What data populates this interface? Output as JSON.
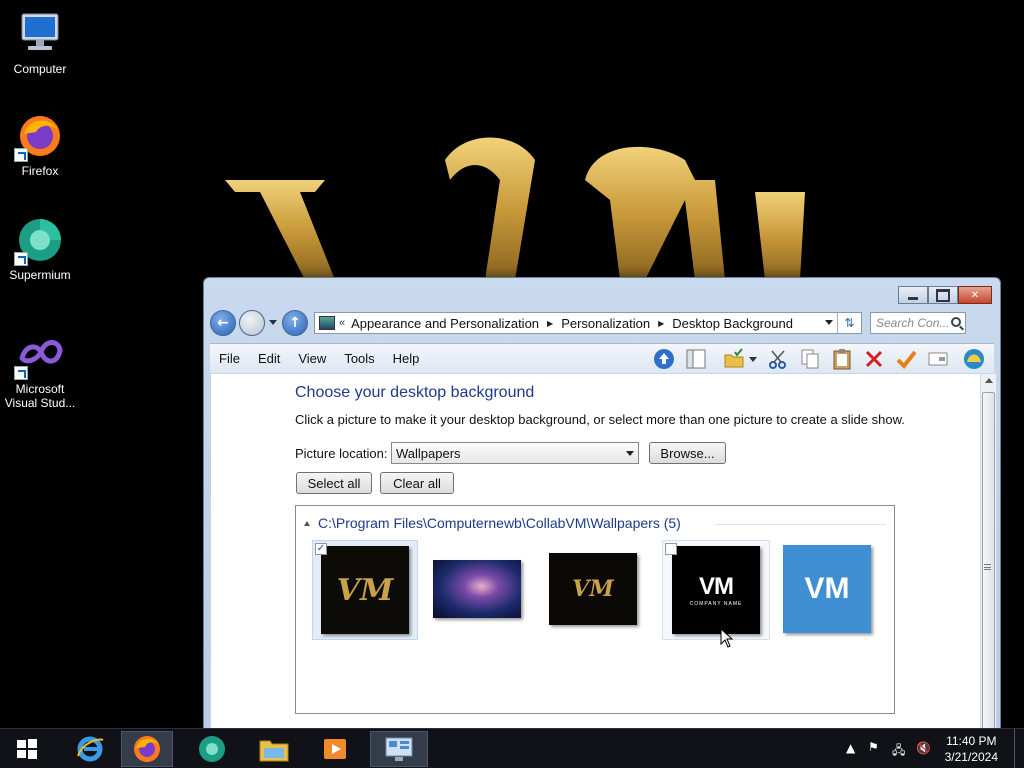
{
  "desktop": {
    "wallpaper_text": "VM",
    "icons": [
      {
        "label": "Computer",
        "icon": "computer-icon"
      },
      {
        "label": "Firefox",
        "icon": "firefox-icon"
      },
      {
        "label": "Supermium",
        "icon": "supermium-icon"
      },
      {
        "label": "Microsoft Visual Stud...",
        "icon": "visual-studio-icon"
      }
    ]
  },
  "window": {
    "address": {
      "overflow": "«",
      "segments": [
        "Appearance and Personalization",
        "Personalization",
        "Desktop Background"
      ]
    },
    "search_placeholder": "Search Con...",
    "menu": [
      "File",
      "Edit",
      "View",
      "Tools",
      "Help"
    ],
    "close_glyph": "✕",
    "title": "Choose your desktop background",
    "subtitle": "Click a picture to make it your desktop background, or select more than one picture to create a slide show.",
    "picture_location_label": "Picture location:",
    "picture_location_value": "Wallpapers",
    "browse_label": "Browse...",
    "select_all_label": "Select all",
    "clear_all_label": "Clear all",
    "folder_path": "C:\\Program Files\\Computernewb\\CollabVM\\Wallpapers (5)",
    "wallpapers": [
      {
        "name": "VM gold logo",
        "checked": true,
        "text": "VM"
      },
      {
        "name": "circuit fingertip",
        "checked": false,
        "text": ""
      },
      {
        "name": "VM gold small",
        "checked": false,
        "text": "VM"
      },
      {
        "name": "VM company name",
        "checked": false,
        "text": "VM",
        "caption": "COMPANY NAME"
      },
      {
        "name": "VM blue",
        "checked": false,
        "text": "VM"
      }
    ]
  },
  "taskbar": {
    "time": "11:40 PM",
    "date": "3/21/2024"
  },
  "colors": {
    "accent_title": "#1e3a8a",
    "gold": "#c9a14a",
    "vm_blue": "#3f8fd2"
  }
}
